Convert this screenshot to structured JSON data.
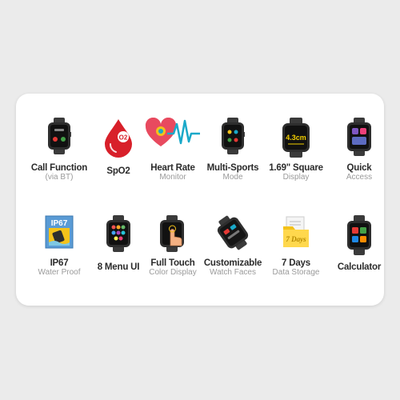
{
  "features": [
    {
      "id": "call",
      "label": "Call Function",
      "sub": "(via BT)",
      "icon": "smartwatch-call-icon"
    },
    {
      "id": "spo2",
      "label": "SpO2",
      "sub": "",
      "icon": "blood-oxygen-drop-icon",
      "icon_text": "O2"
    },
    {
      "id": "hr",
      "label": "Heart Rate",
      "sub": "Monitor",
      "icon": "heart-pulse-icon"
    },
    {
      "id": "sports",
      "label": "Multi-Sports",
      "sub": "Mode",
      "icon": "smartwatch-sports-icon"
    },
    {
      "id": "display",
      "label": "1.69\" Square",
      "sub": "Display",
      "icon": "smartwatch-display-icon",
      "icon_text": "4.3cm"
    },
    {
      "id": "quick",
      "label": "Quick",
      "sub": "Access",
      "icon": "smartwatch-quick-access-icon"
    },
    {
      "id": "ip67",
      "label": "IP67",
      "sub": "Water Proof",
      "icon": "ip67-badge-icon",
      "icon_text": "IP67"
    },
    {
      "id": "menu",
      "label": "8 Menu UI",
      "sub": "",
      "icon": "smartwatch-menu-icon"
    },
    {
      "id": "touch",
      "label": "Full Touch",
      "sub": "Color Display",
      "icon": "smartwatch-touch-icon"
    },
    {
      "id": "faces",
      "label": "Customizable",
      "sub": "Watch Faces",
      "icon": "smartwatch-faces-icon"
    },
    {
      "id": "storage",
      "label": "7 Days",
      "sub": "Data Storage",
      "icon": "folder-storage-icon",
      "icon_text": "7 Days"
    },
    {
      "id": "calc",
      "label": "Calculator",
      "sub": "",
      "icon": "smartwatch-calculator-icon"
    }
  ],
  "colors": {
    "card": "#ffffff",
    "background": "#ebebeb",
    "label": "#2b2b2b",
    "sublabel": "#9a9a9a",
    "watch_body": "#2e2e2e",
    "accent_red": "#d8202a",
    "accent_teal": "#1aa9c9",
    "accent_yellow": "#f4c21a"
  }
}
